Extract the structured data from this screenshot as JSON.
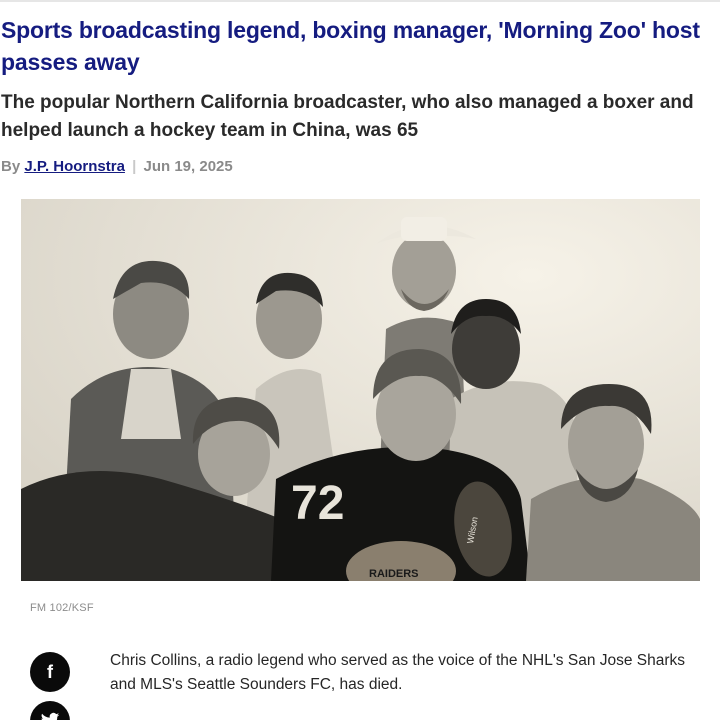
{
  "article": {
    "headline": "Sports broadcasting legend, boxing manager, 'Morning Zoo' host passes away",
    "subheadline": "The popular Northern California broadcaster, who also managed a boxer and helped launch a hockey team in China, was 65",
    "byline_prefix": "By",
    "author": "J.P. Hoornstra",
    "separator": "|",
    "date": "Jun 19, 2025",
    "photo_credit": "FM 102/KSF",
    "body_paragraph": "Chris Collins, a radio legend who served as the voice of the NHL's San Jose Sharks and MLS's Seattle Sounders FC, has died."
  },
  "photo": {
    "jersey_number": "72",
    "football_text": "RAIDERS",
    "ball_brand": "Wilson"
  },
  "share": {
    "facebook_icon": "facebook-icon",
    "facebook_glyph": "f",
    "twitter_icon": "twitter-icon"
  },
  "colors": {
    "headline": "#151c80",
    "author_link": "#151c80",
    "meta_gray": "#8a8a8a",
    "share_button": "#0a0a0a"
  }
}
